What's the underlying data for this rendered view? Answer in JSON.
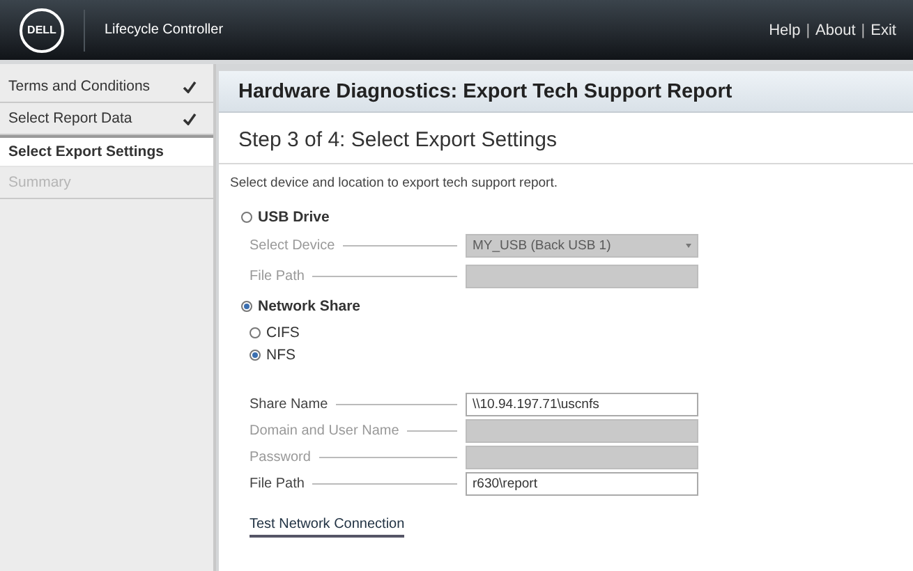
{
  "header": {
    "logo": "DELL",
    "product": "Lifecycle Controller",
    "links": [
      "Help",
      "About",
      "Exit"
    ],
    "separator": "|"
  },
  "sidebar": {
    "steps": [
      {
        "label": "Terms and Conditions",
        "checked": true,
        "selected": false,
        "disabled": false
      },
      {
        "label": "Select Report Data",
        "checked": true,
        "selected": false,
        "disabled": false
      },
      {
        "label": "Select Export Settings",
        "checked": false,
        "selected": true,
        "disabled": false
      },
      {
        "label": "Summary",
        "checked": false,
        "selected": false,
        "disabled": true
      }
    ]
  },
  "panel": {
    "title": "Hardware Diagnostics: Export Tech Support Report",
    "step_heading": "Step 3 of 4: Select Export Settings",
    "description": "Select device and location to export tech support report.",
    "usb": {
      "label": "USB Drive",
      "selected": false,
      "fields": [
        {
          "kind": "select",
          "label": "Select Device",
          "value": "MY_USB (Back USB 1)",
          "disabled": true
        },
        {
          "kind": "text",
          "label": "File Path",
          "disabled": true
        }
      ]
    },
    "network": {
      "label": "Network Share",
      "selected": true,
      "protocols": [
        {
          "label": "CIFS",
          "selected": false
        },
        {
          "label": "NFS",
          "selected": true
        }
      ],
      "fields": [
        {
          "kind": "text",
          "label": "Share Name",
          "value": "\\\\10.94.197.71\\uscnfs",
          "disabled": false
        },
        {
          "kind": "text",
          "label": "Domain and User Name",
          "disabled": true
        },
        {
          "kind": "text",
          "label": "Password",
          "disabled": true
        },
        {
          "kind": "text",
          "label": "File Path",
          "value": "r630\\report",
          "disabled": false
        }
      ]
    },
    "test_link": "Test Network Connection"
  }
}
